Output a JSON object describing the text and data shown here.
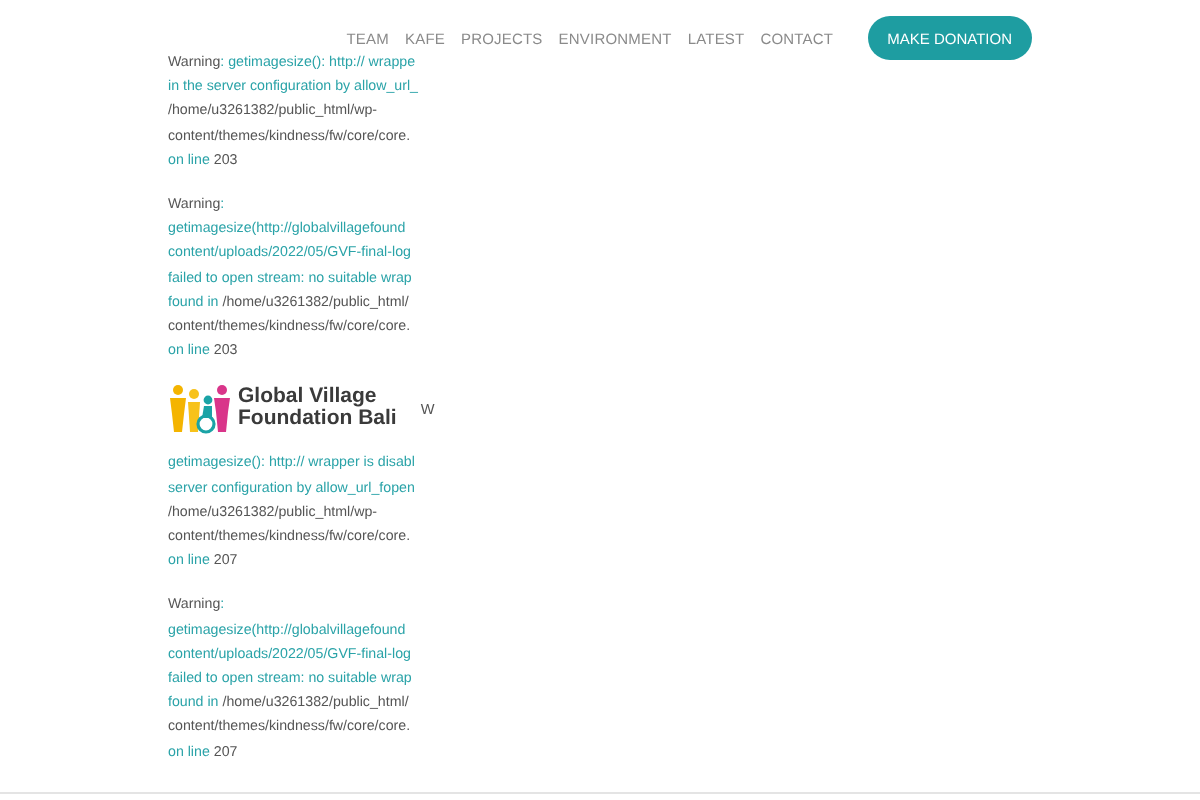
{
  "nav": {
    "items": [
      "TEAM",
      "KAFE",
      "PROJECTS",
      "ENVIRONMENT",
      "LATEST",
      "CONTACT"
    ],
    "button": "MAKE DONATION"
  },
  "blocks": [
    {
      "lines": [
        "**Warning**: getimagesize(): http:// wrappe",
        "in the server configuration by allow_url_",
        "**/home/u3261382/public_html/wp-**",
        "**content/themes/kindness/fw/core/core.**",
        "on line **203**"
      ]
    },
    {
      "lines": [
        "**Warning**:",
        "getimagesize(http://globalvillagefound",
        "content/uploads/2022/05/GVF-final-log",
        "failed to open stream: no suitable wrap",
        "found in **/home/u3261382/public_html/**",
        "**content/themes/kindness/fw/core/core.**",
        "on line **203**"
      ]
    },
    {
      "logo": {
        "name_lines": [
          "Global Village",
          "Foundation Bali"
        ],
        "trailing": "W"
      },
      "lines": [
        "getimagesize(): http:// wrapper is disabl",
        "server configuration by allow_url_fopen",
        "**/home/u3261382/public_html/wp-**",
        "**content/themes/kindness/fw/core/core.**",
        "on line **207**"
      ]
    },
    {
      "lines": [
        "**Warning**:",
        "getimagesize(http://globalvillagefound",
        "content/uploads/2022/05/GVF-final-log",
        "failed to open stream: no suitable wrap",
        "found in **/home/u3261382/public_html/**",
        "**content/themes/kindness/fw/core/core.**",
        "on line **207**"
      ]
    }
  ]
}
